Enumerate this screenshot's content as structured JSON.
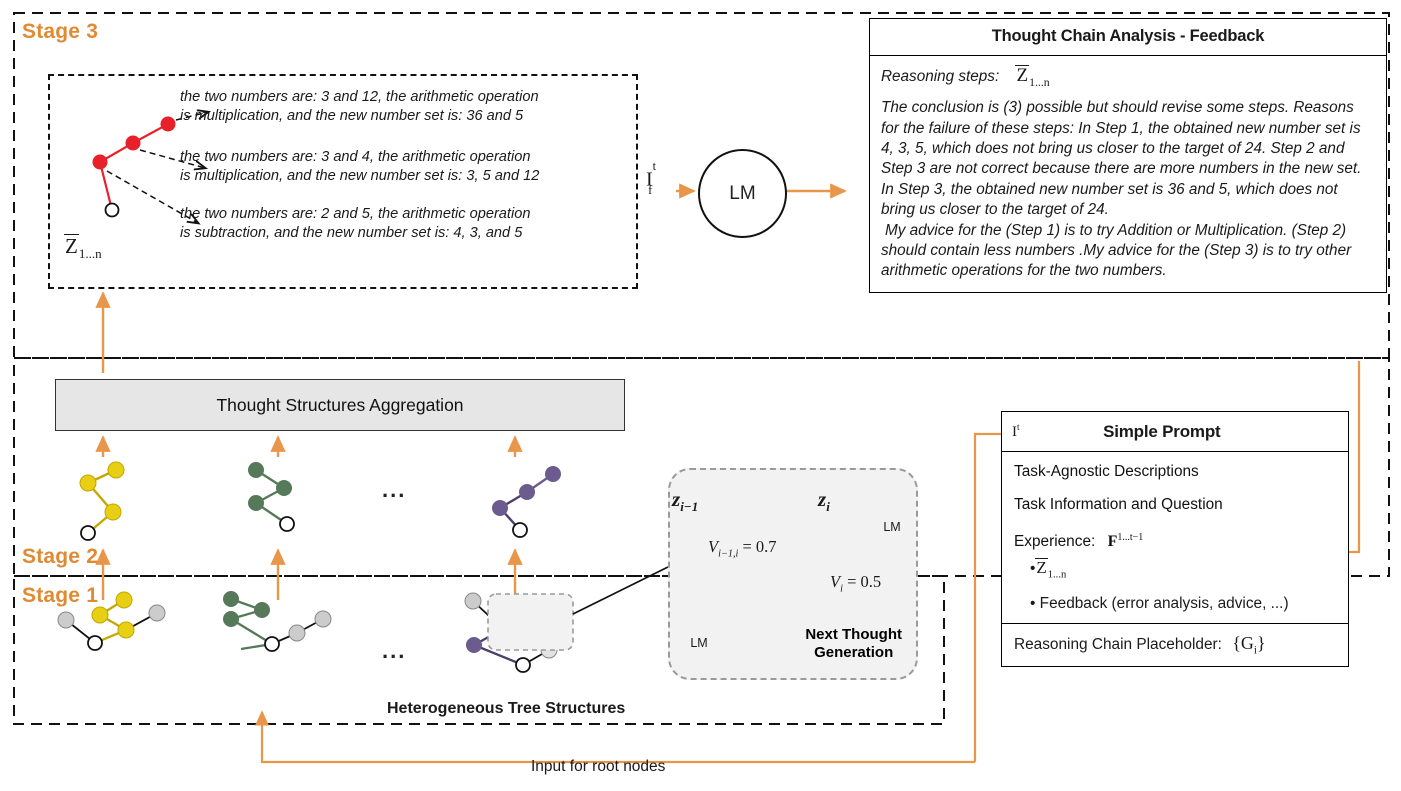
{
  "stages": {
    "stage3": "Stage 3",
    "stage2": "Stage 2",
    "stage1": "Stage 1"
  },
  "feedback": {
    "title": "Thought Chain Analysis - Feedback",
    "reasoning_steps_label": "Reasoning steps:",
    "reasoning_steps_symbol": "Z",
    "reasoning_steps_subscript": "1...n",
    "paragraph1": "The conclusion is (3) possible but should revise some steps. Reasons for the failure of these steps: In Step 1,  the obtained new number set is 4, 3, 5, which does not bring us closer to the target of 24. Step 2 and Step 3 are not correct because there are more numbers in the new set. In Step 3, the obtained new number set is 36 and 5, which does not bring us closer to the target of 24.",
    "paragraph2": "My advice for the (Step 1)  is to try Addition or Multiplication. (Step 2) should contain less numbers .My advice for the  (Step 3)  is to try other arithmetic operations for the two numbers."
  },
  "thought_chain": {
    "z_symbol": "Z",
    "z_subscript": "1...n",
    "branches": [
      "the two numbers are: 3 and 12, the arithmetic operation|is multiplication, and the new number set is: 36 and 5",
      "the two numbers are: 3 and 4, the arithmetic operation|is multiplication, and the new number set is: 3, 5 and 12",
      "the two numbers are: 2 and 5, the arithmetic operation|is subtraction, and the new number set is: 4, 3, and 5"
    ],
    "branch1_line1": "the two numbers are: 3 and 12, the arithmetic operation",
    "branch1_line2": "is multiplication, and the new number set is: 36 and 5",
    "branch2_line1": "the two numbers are: 3 and 4, the arithmetic operation",
    "branch2_line2": "is multiplication, and the new number set is: 3, 5 and 12",
    "branch3_line1": "the two numbers are: 2 and 5, the arithmetic operation",
    "branch3_line2": "is subtraction, and the new number set is: 4, 3, and 5"
  },
  "lm": {
    "label": "LM",
    "input_symbol": "I",
    "input_superscript": "t",
    "input_subscript": "f"
  },
  "aggregation": {
    "label": "Thought Structures Aggregation"
  },
  "next_thought": {
    "title_line1": "Next Thought",
    "title_line2": "Generation",
    "node_prev_label": "z",
    "node_prev_sub": "i−1",
    "node_cur_label": "z",
    "node_cur_sub": "i",
    "lm_label": "LM",
    "edge_value_label": "V",
    "edge_value_sub": "i−1,i",
    "edge_value": "0.7",
    "node_value_label": "V",
    "node_value_sub": "i",
    "node_value": "0.5",
    "edge_value_full": "V i−1,i = 0.7",
    "node_value_full": "V i = 0.5"
  },
  "prompt": {
    "header_symbol": "I",
    "header_superscript": "t",
    "title": "Simple Prompt",
    "row1": "Task-Agnostic Descriptions",
    "row2": "Task Information and Question",
    "row3_label": "Experience:",
    "row3_symbol": "F",
    "row3_superscript": "1...t−1",
    "bullet1_symbol": "Z",
    "bullet1_subscript": "1...n",
    "bullet2": "Feedback (error analysis, advice, ...)",
    "footer_label": "Reasoning Chain Placeholder:",
    "footer_symbol": "{G",
    "footer_subscript": "i",
    "footer_symbol_end": "}"
  },
  "labels": {
    "heterogeneous": "Heterogeneous Tree Structures",
    "input_root_nodes": "Input for root nodes",
    "ellipsis": "..."
  },
  "colors": {
    "accent_orange": "#e8974a",
    "stage_orange": "#e08a34",
    "red_tree": "#e8202a",
    "yellow_node": "#e8cf14",
    "yellow_edge": "#c2a800",
    "green_node": "#56795a",
    "purple_node": "#6b5b8e",
    "grey_node": "#cccccc",
    "white_node": "#ffffff",
    "panel_grey": "#e6e6e6"
  }
}
